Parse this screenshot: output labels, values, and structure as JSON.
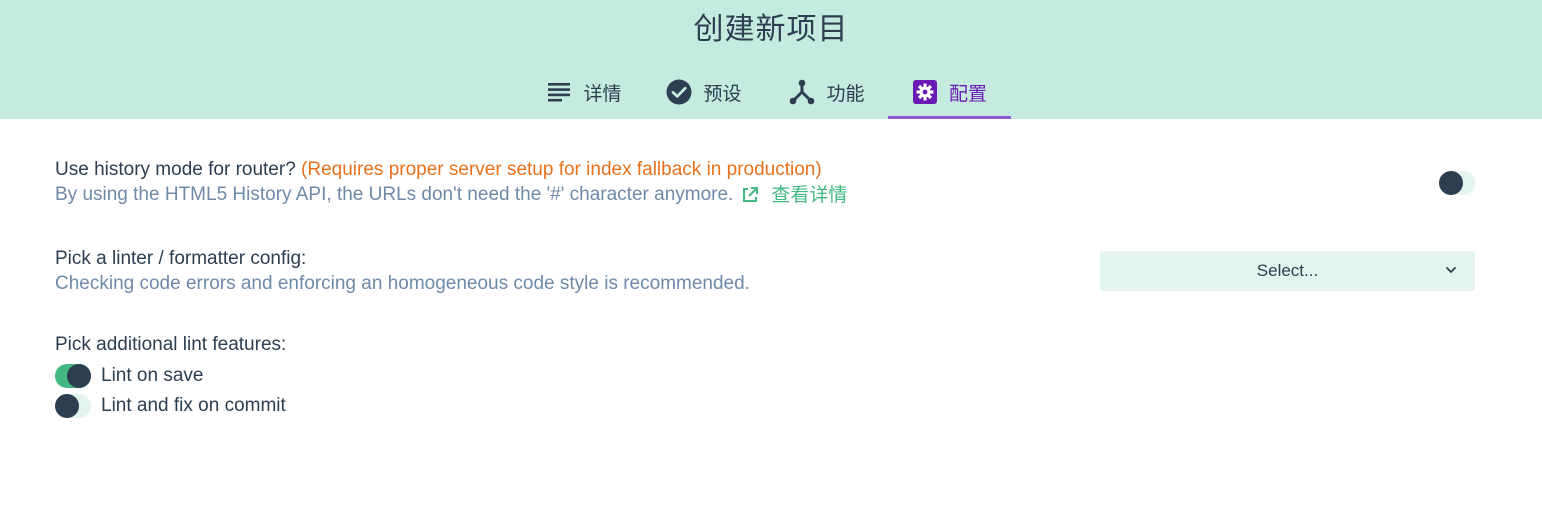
{
  "header": {
    "title": "创建新项目",
    "tabs": [
      {
        "label": "详情",
        "icon": "list-icon",
        "active": false
      },
      {
        "label": "预设",
        "icon": "check-circle-icon",
        "active": false
      },
      {
        "label": "功能",
        "icon": "fork-icon",
        "active": false
      },
      {
        "label": "配置",
        "icon": "gear-icon",
        "active": true
      }
    ]
  },
  "history_mode": {
    "question": "Use history mode for router?",
    "warning": "(Requires proper server setup for index fallback in production)",
    "description": "By using the HTML5 History API, the URLs don't need the '#' character anymore.",
    "more_link": "查看详情",
    "enabled": false
  },
  "linter": {
    "question": "Pick a linter / formatter config:",
    "description": "Checking code errors and enforcing an homogeneous code style is recommended.",
    "select_value": "Select..."
  },
  "lint_features": {
    "question": "Pick additional lint features:",
    "options": [
      {
        "label": "Lint on save",
        "enabled": true
      },
      {
        "label": "Lint and fix on commit",
        "enabled": false
      }
    ]
  },
  "colors": {
    "header_bg": "#c5eadf",
    "accent": "#42b983",
    "active_tab": "#6a1bb3",
    "warning": "#e8711c",
    "description": "#6f89a8",
    "dark": "#2c3e50"
  }
}
